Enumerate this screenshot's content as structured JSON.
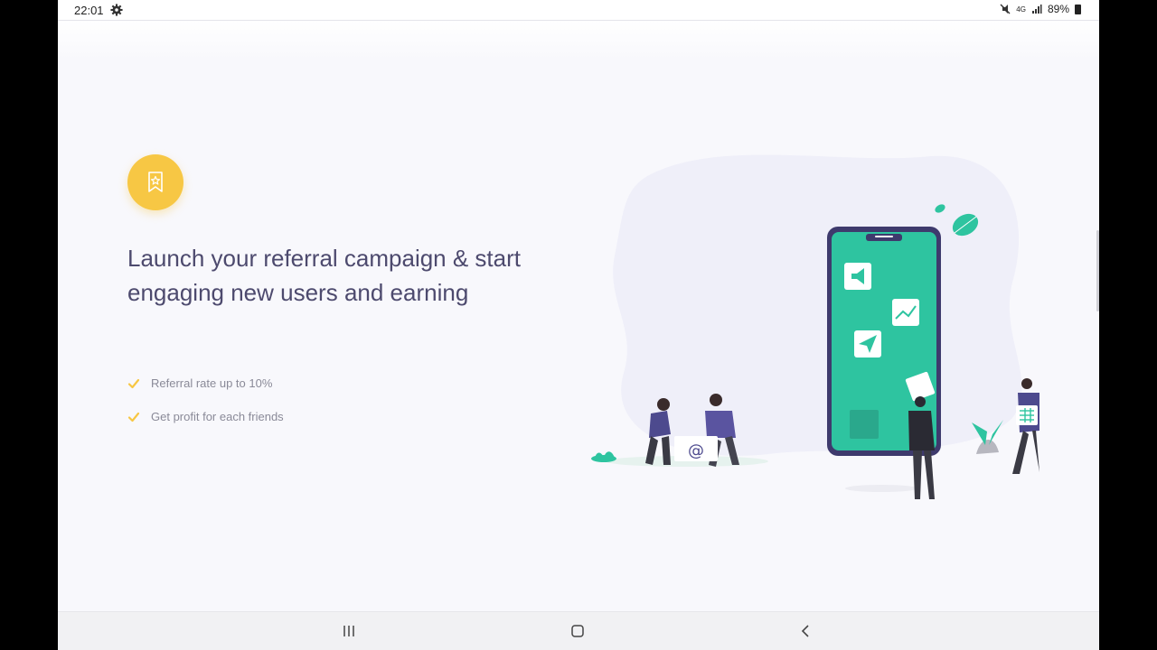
{
  "status_bar": {
    "time": "22:01",
    "battery": "89%",
    "network": "4G",
    "icons": [
      "settings-icon",
      "mute-icon",
      "signal-icon",
      "battery-icon"
    ]
  },
  "hero": {
    "badge_icon": "bookmark-star-icon",
    "headline": "Launch your referral campaign & start engaging new users and earning",
    "features": [
      "Referral rate up to 10%",
      "Get profit for each friends"
    ]
  },
  "illustration": {
    "email_symbol": "@"
  },
  "nav_bar": {
    "buttons": [
      "recent-apps-icon",
      "home-icon",
      "back-icon"
    ]
  },
  "colors": {
    "accent_yellow": "#f7c744",
    "brand_green": "#2ec4a0",
    "text_purple": "#4d4a6e",
    "phone_frame": "#3e3a6d"
  }
}
